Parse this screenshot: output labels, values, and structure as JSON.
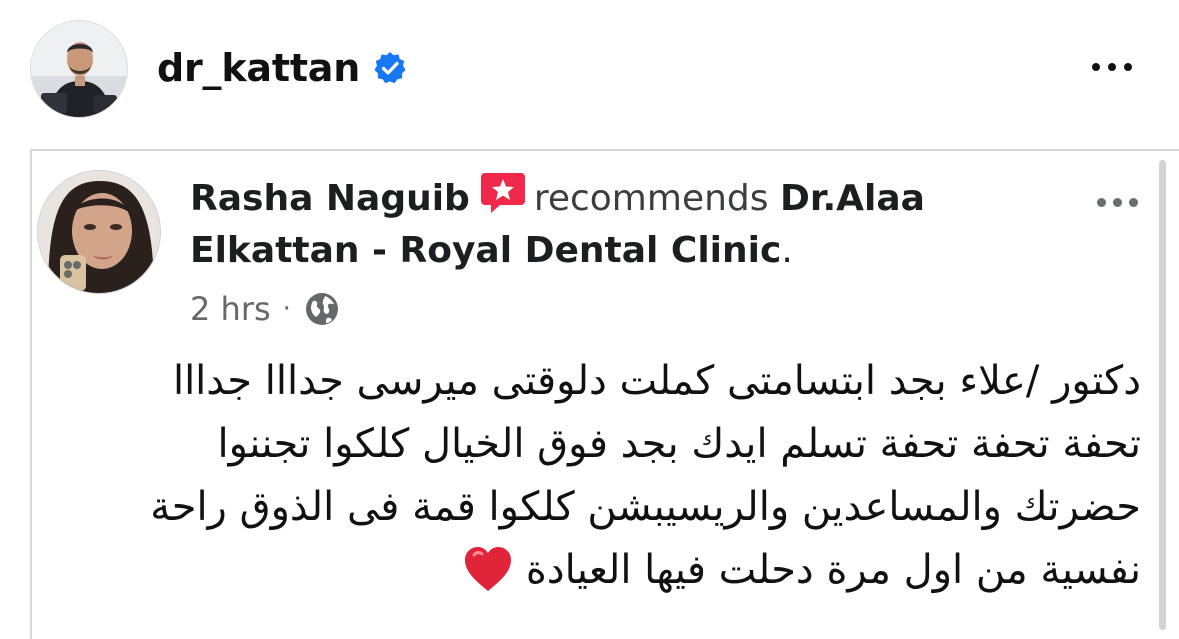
{
  "header": {
    "username": "dr_kattan",
    "verified_icon": "verified-badge-icon",
    "more_icon": "more-horizontal-icon"
  },
  "card": {
    "reviewer_name": "Rasha Naguib",
    "recommend_icon": "recommend-star-icon",
    "recommends_text": "recommends",
    "page_name": "Dr.Alaa Elkattan - Royal Dental Clinic",
    "page_name_end": ".",
    "time": "2 hrs",
    "separator": "·",
    "audience_icon": "globe-public-icon",
    "more_icon": "more-horizontal-icon",
    "review_lines": [
      "دكتور /علاء بجد ابتسامتى كملت دلوقتى ميرسى جدااا جدااا",
      "تحفة تحفة تحفة تسلم ايدك بجد فوق الخيال كلكوا تجننوا",
      "حضرتك والمساعدين والريسيبشن كلكوا قمة فى الذوق راحة",
      "نفسية من اول مرة دحلت فيها العيادة"
    ],
    "heart_icon": "red-heart-icon"
  },
  "colors": {
    "verified_blue": "#1877f2",
    "recommend_red": "#f02849",
    "meta_gray": "#65676b",
    "heart_red": "#e0243a"
  }
}
